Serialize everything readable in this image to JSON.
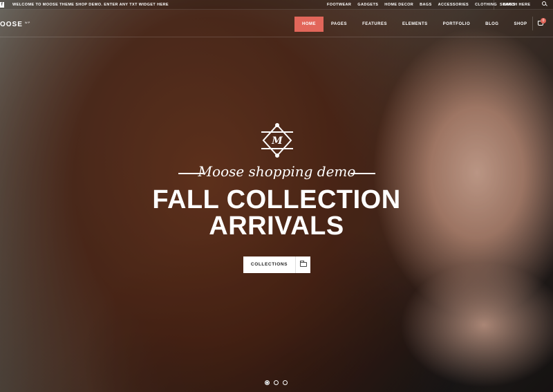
{
  "topbar": {
    "welcome": "WELCOME TO MOOSE THEME SHOP DEMO. ENTER ANY TXT WIDGET HERE",
    "links": [
      "FOOTWEAR",
      "GADGETS",
      "HOME DECOR",
      "BAGS",
      "ACCESSORIES",
      "CLOTHING",
      "BAGS"
    ],
    "search_placeholder": "SEARCH HERE"
  },
  "logo": {
    "text": "OOSE",
    "sup": "WP"
  },
  "nav": {
    "items": [
      "HOME",
      "PAGES",
      "FEATURES",
      "ELEMENTS",
      "PORTFOLIO",
      "BLOG",
      "SHOP"
    ],
    "active_index": 0,
    "cart_count": "0"
  },
  "hero": {
    "emblem_letter": "M",
    "tagline": "Moose shopping demo",
    "headline_line1": "FALL COLLECTION",
    "headline_line2": "ARRIVALS",
    "cta_label": "COLLECTIONS",
    "slides": 3,
    "active_slide": 0
  },
  "colors": {
    "accent": "#e2665a"
  }
}
